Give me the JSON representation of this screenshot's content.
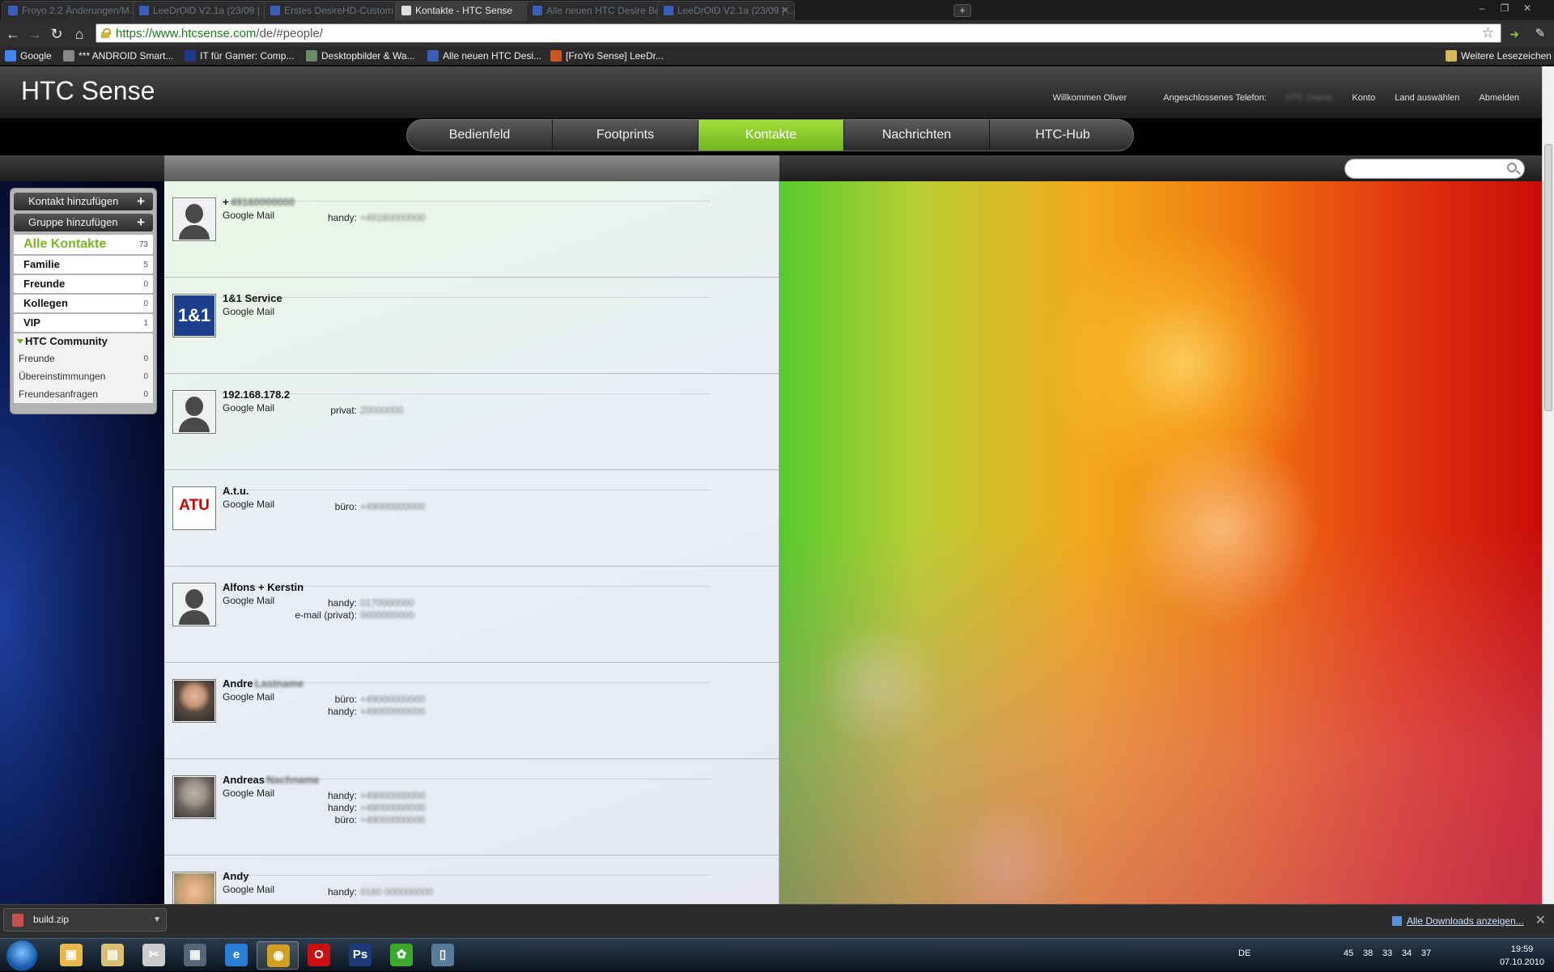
{
  "browser": {
    "tabs": [
      {
        "label": "Froyo 2.2 Änderungen/M..."
      },
      {
        "label": "LeeDrOiD V2.1a (23/09 | ..."
      },
      {
        "label": "Erstes DesireHD-Custom ..."
      },
      {
        "label": "Kontakte - HTC Sense"
      },
      {
        "label": "Alle neuen HTC Desire Be..."
      },
      {
        "label": "LeeDrOiD V2.1a (23/09 | ..."
      }
    ],
    "new_tab": "+",
    "url_host": "https://www.htcsense.com",
    "url_path": "/de/#people/",
    "bookmarks": [
      {
        "label": "Google",
        "color": "#4285f4"
      },
      {
        "label": "*** ANDROID Smart...",
        "color": "#888888"
      },
      {
        "label": "IT für Gamer: Comp...",
        "color": "#1d3a8a"
      },
      {
        "label": "Desktopbilder & Wa...",
        "color": "#6a8a6a"
      },
      {
        "label": "Alle neuen HTC Desi...",
        "color": "#3a5fb8"
      },
      {
        "label": "[FroYo Sense] LeeDr...",
        "color": "#cc5522"
      }
    ],
    "other_bookmarks": "Weitere Lesezeichen"
  },
  "header": {
    "brand": "HTC Sense",
    "links": [
      "Willkommen Oliver",
      "Angeschlossenes Telefon:",
      "Konto",
      "Land auswählen",
      "Abmelden"
    ],
    "phone_value": "HTC Desire"
  },
  "nav": {
    "tabs": [
      "Bedienfeld",
      "Footprints",
      "Kontakte",
      "Nachrichten",
      "HTC-Hub"
    ],
    "active": "Kontakte",
    "accent": "#8cc832"
  },
  "sidebar": {
    "add_contact": "Kontakt hinzufügen",
    "add_group": "Gruppe hinzufügen",
    "groups": [
      {
        "label": "Alle Kontakte",
        "count": "73"
      },
      {
        "label": "Familie",
        "count": "5"
      },
      {
        "label": "Freunde",
        "count": "0"
      },
      {
        "label": "Kollegen",
        "count": "0"
      },
      {
        "label": "VIP",
        "count": "1"
      }
    ],
    "community_title": "HTC Community",
    "community": [
      {
        "label": "Freunde",
        "count": "0"
      },
      {
        "label": "Übereinstimmungen",
        "count": "0"
      },
      {
        "label": "Freundesanfragen",
        "count": "0"
      }
    ]
  },
  "contacts": [
    {
      "name": "+",
      "name_hidden": "49160000000",
      "source": "Google Mail",
      "avatar": "placeholder",
      "phones": [
        {
          "label": "handy:",
          "value": "+49160000000"
        }
      ]
    },
    {
      "name": "1&1 Service",
      "name_hidden": "",
      "source": "Google Mail",
      "avatar": "logo-1und1",
      "logo_text": "1&1",
      "phones": []
    },
    {
      "name": "192.168.178.2",
      "name_hidden": "",
      "source": "Google Mail",
      "avatar": "placeholder",
      "phones": [
        {
          "label": "privat:",
          "value": "20000000"
        }
      ]
    },
    {
      "name": "A.t.u.",
      "name_hidden": "",
      "source": "Google Mail",
      "avatar": "logo-atu",
      "logo_text": "ATU",
      "phones": [
        {
          "label": "büro:",
          "value": "+49000000000"
        }
      ]
    },
    {
      "name": "Alfons + Kerstin",
      "name_hidden": "",
      "source": "Google Mail",
      "avatar": "placeholder",
      "phones": [
        {
          "label": "handy:",
          "value": "0170000000"
        },
        {
          "label": "e-mail (privat):",
          "value": "0000000000"
        }
      ]
    },
    {
      "name": "Andre",
      "name_hidden": "Lastname",
      "source": "Google Mail",
      "avatar": "photo",
      "phones": [
        {
          "label": "büro:",
          "value": "+49000000000"
        },
        {
          "label": "handy:",
          "value": "+49000000000"
        }
      ]
    },
    {
      "name": "Andreas",
      "name_hidden": "Nachname",
      "source": "Google Mail",
      "avatar": "photo",
      "phones": [
        {
          "label": "handy:",
          "value": "+49000000000"
        },
        {
          "label": "handy:",
          "value": "+49000000000"
        },
        {
          "label": "büro:",
          "value": "+49000000000"
        }
      ]
    },
    {
      "name": "Andy",
      "name_hidden": "",
      "source": "Google Mail",
      "avatar": "photo",
      "phones": [
        {
          "label": "handy:",
          "value": "0160 000000000"
        }
      ]
    }
  ],
  "downloads": {
    "file": "build.zip",
    "show_all": "Alle Downloads anzeigen..."
  },
  "taskbar": {
    "language": "DE",
    "tray_numbers": [
      "45",
      "38",
      "33",
      "34",
      "37"
    ],
    "time": "19:59",
    "date": "07.10.2010",
    "apps": [
      {
        "name": "explorer",
        "glyph": "▣",
        "color": "#e8b84a"
      },
      {
        "name": "folder",
        "glyph": "▤",
        "color": "#d8c070"
      },
      {
        "name": "tools",
        "glyph": "✂",
        "color": "#cccccc"
      },
      {
        "name": "desktop",
        "glyph": "▦",
        "color": "#556677"
      },
      {
        "name": "ie",
        "glyph": "e",
        "color": "#2a7fd4"
      },
      {
        "name": "chrome",
        "glyph": "◉",
        "color": "#d0a020"
      },
      {
        "name": "opera",
        "glyph": "O",
        "color": "#cc1010"
      },
      {
        "name": "photoshop",
        "glyph": "Ps",
        "color": "#1c3a78"
      },
      {
        "name": "icq",
        "glyph": "✿",
        "color": "#3aa82a"
      },
      {
        "name": "phone",
        "glyph": "▯",
        "color": "#5a7a9a"
      }
    ]
  }
}
